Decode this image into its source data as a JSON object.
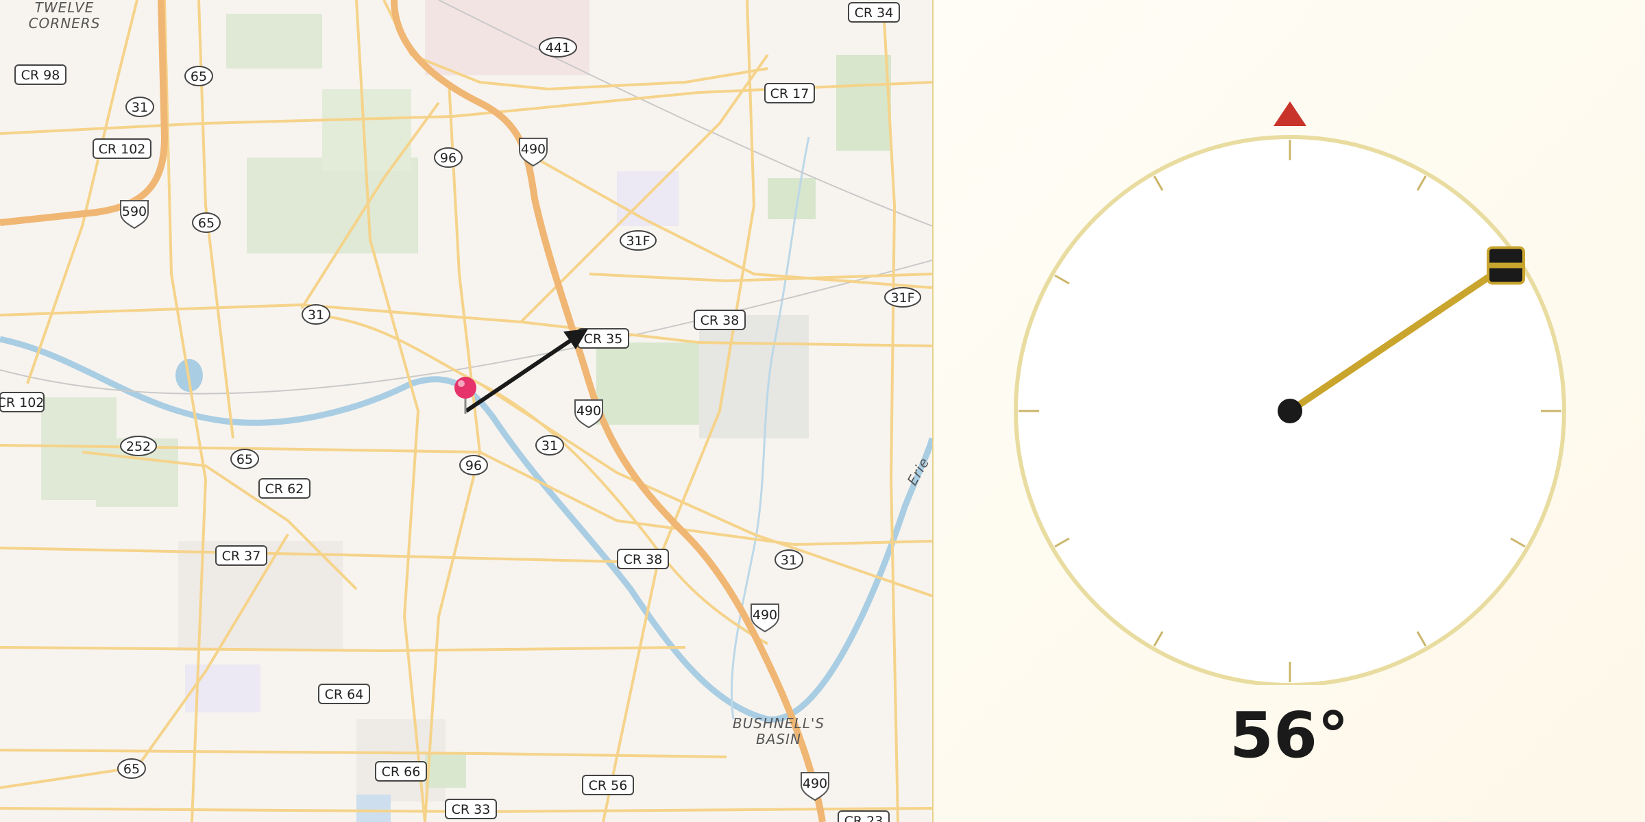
{
  "map": {
    "place_labels": [
      "TWELVE",
      "CORNERS",
      "BUSHNELL'S",
      "BASIN"
    ],
    "road_labels": {
      "cr34": "CR 34",
      "cr98": "CR 98",
      "cr102": "CR 102",
      "cr17": "CR 17",
      "cr35": "CR 35",
      "cr38a": "CR 38",
      "cr38b": "CR 38",
      "cr62": "CR 62",
      "cr37": "CR 37",
      "cr64": "CR 64",
      "cr66": "CR 66",
      "cr56": "CR 56",
      "cr33": "CR 33",
      "cr23": "CR 23",
      "r441": "441",
      "r65a": "65",
      "r65b": "65",
      "r65c": "65",
      "r65d": "65",
      "r31a": "31",
      "r31b": "31",
      "r31c": "31",
      "r31d": "31",
      "r96a": "96",
      "r96b": "96",
      "r252": "252",
      "r31fa": "31F",
      "r31fb": "31F",
      "i490a": "490",
      "i490b": "490",
      "i490c": "490",
      "i490d": "490",
      "i590": "590"
    },
    "water_label": "Erie",
    "pin": {
      "color": "#e6336b",
      "icon": "map-pin-icon"
    },
    "heading_arrow": {
      "icon": "direction-arrow-icon"
    }
  },
  "compass": {
    "heading_deg": 56,
    "heading_text": "56°",
    "north_marker_color": "#c9342a",
    "needle_color": "#c9a52e",
    "ring_color": "#e9dca0"
  }
}
